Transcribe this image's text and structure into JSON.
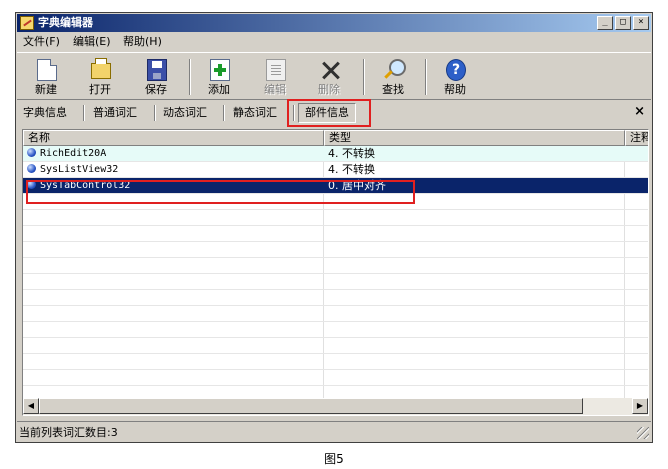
{
  "window": {
    "title": "字典编辑器",
    "controls": {
      "minimize": "_",
      "maximize": "□",
      "close": "×"
    }
  },
  "menu": [
    "文件(F)",
    "编辑(E)",
    "帮助(H)"
  ],
  "toolbar": {
    "new": {
      "label": "新建",
      "icon": "new-file-icon"
    },
    "open": {
      "label": "打开",
      "icon": "folder-open-icon"
    },
    "save": {
      "label": "保存",
      "icon": "floppy-disk-icon"
    },
    "add": {
      "label": "添加",
      "icon": "add-document-icon"
    },
    "edit": {
      "label": "编辑",
      "icon": "edit-document-icon",
      "enabled": false
    },
    "delete": {
      "label": "删除",
      "icon": "delete-x-icon",
      "enabled": false
    },
    "find": {
      "label": "查找",
      "icon": "magnifier-icon"
    },
    "help": {
      "label": "帮助",
      "icon": "help-icon",
      "glyph": "?"
    }
  },
  "tabs": [
    "字典信息",
    "普通词汇",
    "动态词汇",
    "静态词汇",
    "部件信息"
  ],
  "active_tab": "部件信息",
  "tab_close": "×",
  "list": {
    "columns": [
      "名称",
      "类型",
      "注释"
    ],
    "rows": [
      {
        "name": "RichEdit20A",
        "type": "4. 不转换"
      },
      {
        "name": "SysListView32",
        "type": "4. 不转换"
      },
      {
        "name": "SysTabControl32",
        "type": "0. 居中对齐"
      }
    ],
    "selected_row": 3
  },
  "scroll": {
    "left_arrow": "◀",
    "right_arrow": "▶"
  },
  "status": {
    "text": "当前列表词汇数目:3"
  },
  "caption": "图5",
  "colors": {
    "title_start": "#0a246a",
    "title_end": "#a6caf0",
    "selection": "#0a246a",
    "highlight": "#e02020",
    "row_tint": "#e6fbf8"
  }
}
